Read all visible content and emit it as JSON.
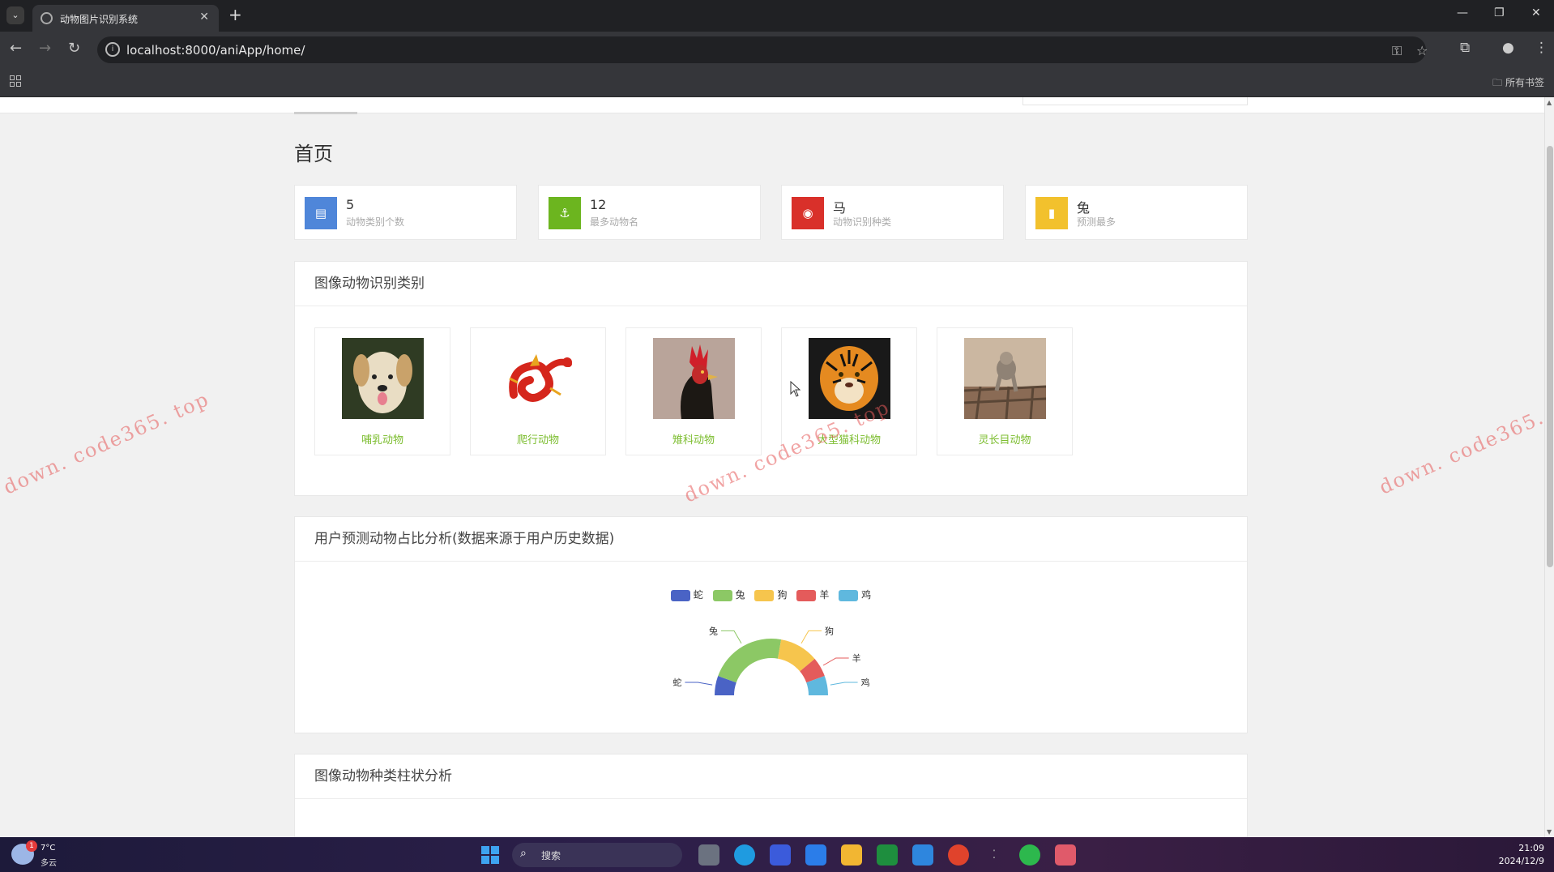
{
  "browser": {
    "tab_title": "动物图片识别系统",
    "new_tab": "+",
    "url": "localhost:8000/aniApp/home/",
    "bookmarks_label": "所有书签"
  },
  "page": {
    "title": "首页"
  },
  "stats": [
    {
      "value": "5",
      "label": "动物类别个数",
      "icon": "database-icon",
      "color": "#4f86d9"
    },
    {
      "value": "12",
      "label": "最多动物名",
      "icon": "anchor-icon",
      "color": "#6cb51f"
    },
    {
      "value": "马",
      "label": "动物识别种类",
      "icon": "eye-icon",
      "color": "#d9302a"
    },
    {
      "value": "兔",
      "label": "预测最多",
      "icon": "bar-chart-icon",
      "color": "#f2c12d"
    }
  ],
  "categories": {
    "title": "图像动物识别类别",
    "items": [
      {
        "name": "哺乳动物",
        "image": "dog-photo"
      },
      {
        "name": "爬行动物",
        "image": "red-dragon-illustration"
      },
      {
        "name": "雉科动物",
        "image": "rooster-photo"
      },
      {
        "name": "大型猫科动物",
        "image": "tiger-photo"
      },
      {
        "name": "灵长目动物",
        "image": "monkey-photo"
      }
    ]
  },
  "analysis": {
    "title": "用户预测动物占比分析(数据来源于用户历史数据)"
  },
  "chart_data": {
    "type": "pie",
    "legend": [
      "蛇",
      "兔",
      "狗",
      "羊",
      "鸡"
    ],
    "slice_labels": [
      "蛇",
      "兔",
      "狗",
      "羊",
      "鸡"
    ],
    "values": [
      1,
      4,
      2,
      1,
      1
    ],
    "colors": [
      "#4a63c5",
      "#8cc865",
      "#f6c54d",
      "#e45b5b",
      "#5fb8de"
    ],
    "legend_position": "top-center",
    "shape": "half-donut"
  },
  "bar_section": {
    "title": "图像动物种类柱状分析"
  },
  "watermark": "down. code365. top",
  "taskbar": {
    "temperature": "7°C",
    "weather": "多云",
    "weather_badge": "1",
    "search_placeholder": "搜索",
    "time": "21:09",
    "date": "2024/12/9"
  }
}
